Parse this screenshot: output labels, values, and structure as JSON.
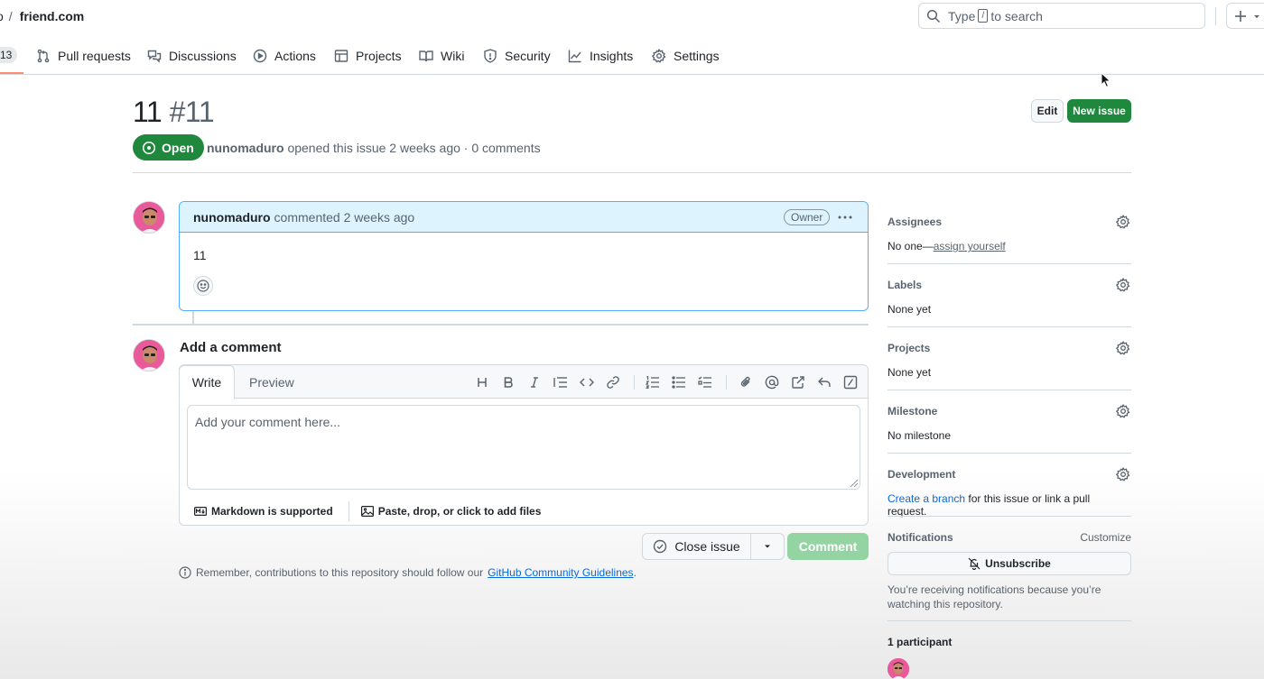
{
  "header": {
    "owner": "o",
    "separator": "/",
    "repo": "friend.com",
    "search_prefix": "Type",
    "search_key": "/",
    "search_suffix": "to search",
    "create_label": "+"
  },
  "repo_nav": {
    "active_count": "13",
    "tabs": [
      {
        "label": "Pull requests",
        "icon": "pull-request-icon"
      },
      {
        "label": "Discussions",
        "icon": "discussions-icon"
      },
      {
        "label": "Actions",
        "icon": "actions-play-icon"
      },
      {
        "label": "Projects",
        "icon": "projects-table-icon"
      },
      {
        "label": "Wiki",
        "icon": "book-icon"
      },
      {
        "label": "Security",
        "icon": "shield-icon"
      },
      {
        "label": "Insights",
        "icon": "graph-icon"
      },
      {
        "label": "Settings",
        "icon": "gear-icon"
      }
    ]
  },
  "issue": {
    "title": "11",
    "number": "#11",
    "state": "Open",
    "author": "nunomaduro",
    "meta_text": "opened this issue 2 weeks ago · 0 comments",
    "edit_label": "Edit",
    "new_issue_label": "New issue"
  },
  "comment": {
    "author": "nunomaduro",
    "meta": "commented 2 weeks ago",
    "badge": "Owner",
    "body": "11"
  },
  "composer": {
    "title": "Add a comment",
    "tab_write": "Write",
    "tab_preview": "Preview",
    "placeholder": "Add your comment here...",
    "markdown_note": "Markdown is supported",
    "attach_note": "Paste, drop, or click to add files",
    "close_issue_label": "Close issue",
    "comment_label": "Comment",
    "guidelines_prefix": "Remember, contributions to this repository should follow our",
    "guidelines_link": "GitHub Community Guidelines",
    "guidelines_suffix": "."
  },
  "sidebar": {
    "assignees": {
      "title": "Assignees",
      "value_prefix": "No one—",
      "value_link": "assign yourself"
    },
    "labels": {
      "title": "Labels",
      "value": "None yet"
    },
    "projects": {
      "title": "Projects",
      "value": "None yet"
    },
    "milestone": {
      "title": "Milestone",
      "value": "No milestone"
    },
    "development": {
      "title": "Development",
      "link": "Create a branch",
      "suffix": "for this issue or link a pull request."
    },
    "notifications": {
      "title": "Notifications",
      "customize": "Customize",
      "unsubscribe": "Unsubscribe",
      "note": "You’re receiving notifications because you’re watching this repository."
    },
    "participants": {
      "title": "1 participant"
    }
  },
  "colors": {
    "primary_green": "#1f883d",
    "disabled_green": "#94d3a2",
    "link_blue": "#0969da",
    "comment_header_bg": "#ddf4ff",
    "nav_underline": "#fd8c73"
  }
}
